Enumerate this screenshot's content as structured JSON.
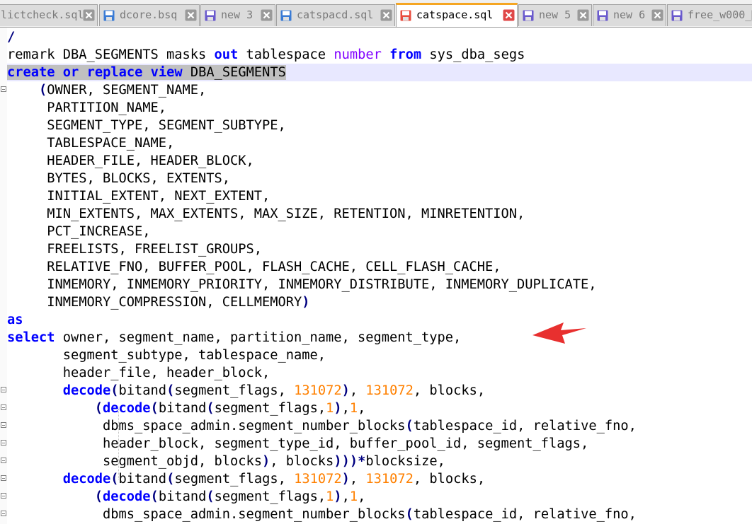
{
  "tabs": [
    {
      "label": "lictcheck.sql",
      "icon": "floppy-disk-blue-icon",
      "active": false
    },
    {
      "label": "dcore.bsq",
      "icon": "floppy-disk-blue-icon",
      "active": false
    },
    {
      "label": "new 3",
      "icon": "floppy-disk-purple-icon",
      "active": false
    },
    {
      "label": "catspacd.sql",
      "icon": "floppy-disk-blue-icon",
      "active": false
    },
    {
      "label": "catspace.sql",
      "icon": "floppy-disk-red-icon",
      "active": true
    },
    {
      "label": "new 5",
      "icon": "floppy-disk-purple-icon",
      "active": false
    },
    {
      "label": "new 6",
      "icon": "floppy-disk-purple-icon",
      "active": false
    },
    {
      "label": "free_w000_",
      "icon": "floppy-disk-purple-icon",
      "active": false
    }
  ],
  "colors": {
    "keyword": "#0000ff",
    "type_keyword": "#8000ff",
    "number": "#ff8000",
    "operator": "#000080",
    "current_line": "#e8e8ff",
    "selection": "#c0c0c0",
    "active_tab_accent": "#f5a623",
    "annotation_arrow": "#e8302f"
  },
  "code": [
    [
      [
        "op",
        "/"
      ]
    ],
    [
      [
        "",
        "remark DBA_SEGMENTS masks "
      ],
      [
        "kw",
        "out"
      ],
      [
        "",
        " tablespace "
      ],
      [
        "kw2",
        "number"
      ],
      [
        "",
        " "
      ],
      [
        "kw",
        "from"
      ],
      [
        "",
        " sys_dba_segs"
      ]
    ],
    [
      [
        "kw sel",
        "create"
      ],
      [
        "sel",
        " "
      ],
      [
        "kw sel",
        "or"
      ],
      [
        "sel",
        " "
      ],
      [
        "kw sel",
        "replace"
      ],
      [
        "sel",
        " "
      ],
      [
        "kw sel",
        "view"
      ],
      [
        "sel",
        " DBA_SEGMENTS"
      ]
    ],
    [
      [
        "",
        "    "
      ],
      [
        "op",
        "("
      ],
      [
        "",
        "OWNER, SEGMENT_NAME,"
      ]
    ],
    [
      [
        "",
        "     PARTITION_NAME,"
      ]
    ],
    [
      [
        "",
        "     SEGMENT_TYPE, SEGMENT_SUBTYPE,"
      ]
    ],
    [
      [
        "",
        "     TABLESPACE_NAME,"
      ]
    ],
    [
      [
        "",
        "     HEADER_FILE, HEADER_BLOCK,"
      ]
    ],
    [
      [
        "",
        "     BYTES, BLOCKS, EXTENTS,"
      ]
    ],
    [
      [
        "",
        "     INITIAL_EXTENT, NEXT_EXTENT,"
      ]
    ],
    [
      [
        "",
        "     MIN_EXTENTS, MAX_EXTENTS, MAX_SIZE, RETENTION, MINRETENTION,"
      ]
    ],
    [
      [
        "",
        "     PCT_INCREASE,"
      ]
    ],
    [
      [
        "",
        "     FREELISTS, FREELIST_GROUPS,"
      ]
    ],
    [
      [
        "",
        "     RELATIVE_FNO, BUFFER_POOL, FLASH_CACHE, CELL_FLASH_CACHE,"
      ]
    ],
    [
      [
        "",
        "     INMEMORY, INMEMORY_PRIORITY, INMEMORY_DISTRIBUTE, INMEMORY_DUPLICATE,"
      ]
    ],
    [
      [
        "",
        "     INMEMORY_COMPRESSION, CELLMEMORY"
      ],
      [
        "op",
        ")"
      ]
    ],
    [
      [
        "kw",
        "as"
      ]
    ],
    [
      [
        "kw",
        "select"
      ],
      [
        "",
        " owner, segment_name, partition_name, segment_type,"
      ]
    ],
    [
      [
        "",
        "       segment_subtype, tablespace_name,"
      ]
    ],
    [
      [
        "",
        "       header_file, header_block,"
      ]
    ],
    [
      [
        "",
        "       "
      ],
      [
        "kw",
        "decode"
      ],
      [
        "op",
        "("
      ],
      [
        "",
        "bitand"
      ],
      [
        "op",
        "("
      ],
      [
        "",
        "segment_flags, "
      ],
      [
        "num",
        "131072"
      ],
      [
        "op",
        ")"
      ],
      [
        "",
        ", "
      ],
      [
        "num",
        "131072"
      ],
      [
        "",
        ", blocks,"
      ]
    ],
    [
      [
        "",
        "           "
      ],
      [
        "op",
        "("
      ],
      [
        "kw",
        "decode"
      ],
      [
        "op",
        "("
      ],
      [
        "",
        "bitand"
      ],
      [
        "op",
        "("
      ],
      [
        "",
        "segment_flags,"
      ],
      [
        "num",
        "1"
      ],
      [
        "op",
        ")"
      ],
      [
        "",
        ","
      ],
      [
        "num",
        "1"
      ],
      [
        "",
        ","
      ]
    ],
    [
      [
        "",
        "            dbms_space_admin.segment_number_blocks"
      ],
      [
        "op",
        "("
      ],
      [
        "",
        "tablespace_id, relative_fno,"
      ]
    ],
    [
      [
        "",
        "            header_block, segment_type_id, buffer_pool_id, segment_flags,"
      ]
    ],
    [
      [
        "",
        "            segment_objd, blocks"
      ],
      [
        "op",
        ")"
      ],
      [
        "",
        ", blocks"
      ],
      [
        "op",
        ")))*"
      ],
      [
        "",
        "blocksize,"
      ]
    ],
    [
      [
        "",
        "       "
      ],
      [
        "kw",
        "decode"
      ],
      [
        "op",
        "("
      ],
      [
        "",
        "bitand"
      ],
      [
        "op",
        "("
      ],
      [
        "",
        "segment_flags, "
      ],
      [
        "num",
        "131072"
      ],
      [
        "op",
        ")"
      ],
      [
        "",
        ", "
      ],
      [
        "num",
        "131072"
      ],
      [
        "",
        ", blocks,"
      ]
    ],
    [
      [
        "",
        "           "
      ],
      [
        "op",
        "("
      ],
      [
        "kw",
        "decode"
      ],
      [
        "op",
        "("
      ],
      [
        "",
        "bitand"
      ],
      [
        "op",
        "("
      ],
      [
        "",
        "segment_flags,"
      ],
      [
        "num",
        "1"
      ],
      [
        "op",
        ")"
      ],
      [
        "",
        ","
      ],
      [
        "num",
        "1"
      ],
      [
        "",
        ","
      ]
    ],
    [
      [
        "",
        "            dbms_space_admin.segment_number_blocks"
      ],
      [
        "op",
        "("
      ],
      [
        "",
        "tablespace_id, relative_fno,"
      ]
    ]
  ]
}
